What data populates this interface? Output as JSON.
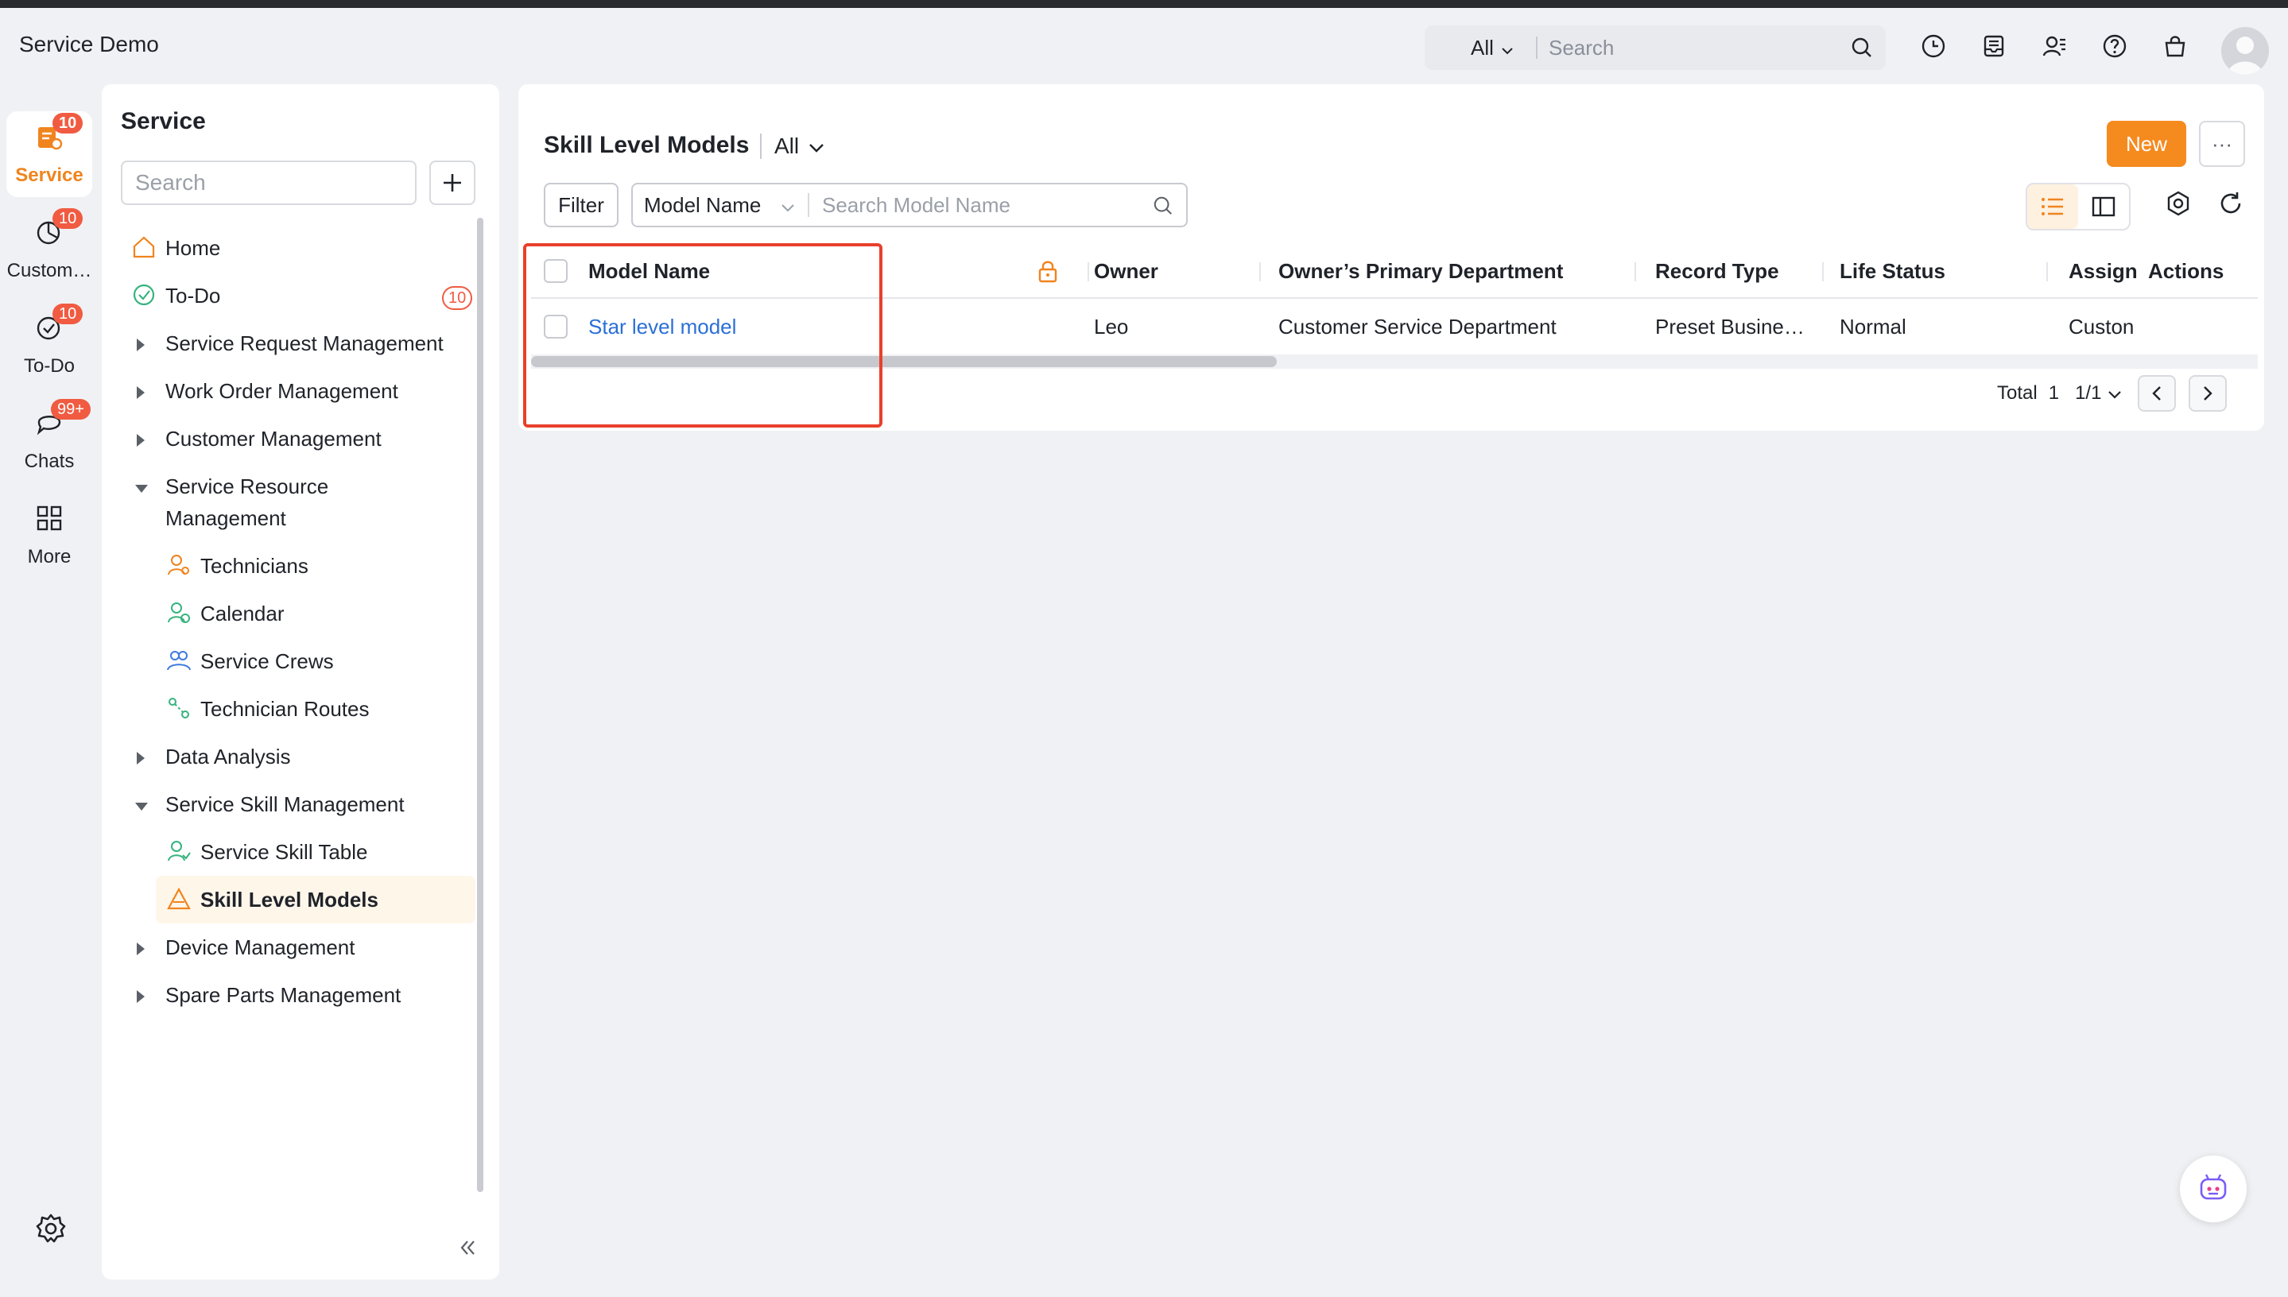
{
  "app": {
    "title": "Service Demo"
  },
  "header": {
    "search_scope": "All",
    "search_placeholder": "Search",
    "icons": [
      "clock-icon",
      "inbox-icon",
      "contacts-icon",
      "help-icon",
      "bag-icon"
    ]
  },
  "rail": {
    "items": [
      {
        "label": "Service",
        "badge": "10",
        "icon": "service-icon",
        "active": true
      },
      {
        "label": "Custom…",
        "badge": "10",
        "icon": "pie-chart-icon"
      },
      {
        "label": "To-Do",
        "badge": "10",
        "icon": "check-circle-icon"
      },
      {
        "label": "Chats",
        "badge": "99+",
        "icon": "chat-bubble-icon"
      },
      {
        "label": "More",
        "icon": "grid-icon"
      }
    ]
  },
  "sidebar": {
    "title": "Service",
    "search_placeholder": "Search",
    "items": [
      {
        "label": "Home",
        "icon": "home-icon"
      },
      {
        "label": "To-Do",
        "icon": "check-circle-icon",
        "count": "10"
      },
      {
        "label": "Service Request Management",
        "expanded": false
      },
      {
        "label": "Work Order Management",
        "expanded": false
      },
      {
        "label": "Customer Management",
        "expanded": false
      },
      {
        "label": "Service Resource Management",
        "expanded": true
      },
      {
        "label": "Technicians",
        "icon": "technician-icon"
      },
      {
        "label": "Calendar",
        "icon": "calendar-icon"
      },
      {
        "label": "Service Crews",
        "icon": "crew-icon"
      },
      {
        "label": "Technician Routes",
        "icon": "route-icon"
      },
      {
        "label": "Data Analysis",
        "expanded": false
      },
      {
        "label": "Service Skill Management",
        "expanded": true
      },
      {
        "label": "Service Skill Table",
        "icon": "skill-icon"
      },
      {
        "label": "Skill Level Models",
        "icon": "triangle-icon",
        "active": true
      },
      {
        "label": "Device Management",
        "expanded": false
      },
      {
        "label": "Spare Parts Management",
        "expanded": false
      }
    ]
  },
  "main": {
    "title": "Skill Level Models",
    "view": "All",
    "new_label": "New",
    "more_label": "···",
    "filter_label": "Filter",
    "field_selector": "Model Name",
    "search_placeholder": "Search Model Name",
    "columns": [
      "Model Name",
      "Owner",
      "Owner’s Primary Department",
      "Record Type",
      "Life Status",
      "Assign",
      "Actions"
    ],
    "rows": [
      {
        "model_name": "Star level model",
        "owner": "Leo",
        "department": "Customer Service Department",
        "record_type": "Preset Busine…",
        "life_status": "Normal",
        "assign": "Custon"
      }
    ],
    "pager": {
      "total_label": "Total",
      "total": "1",
      "page": "1/1"
    }
  },
  "colors": {
    "accent": "#f58a1f",
    "link": "#2b6fd6",
    "badge": "#f05b41",
    "highlight": "#e8402c"
  }
}
